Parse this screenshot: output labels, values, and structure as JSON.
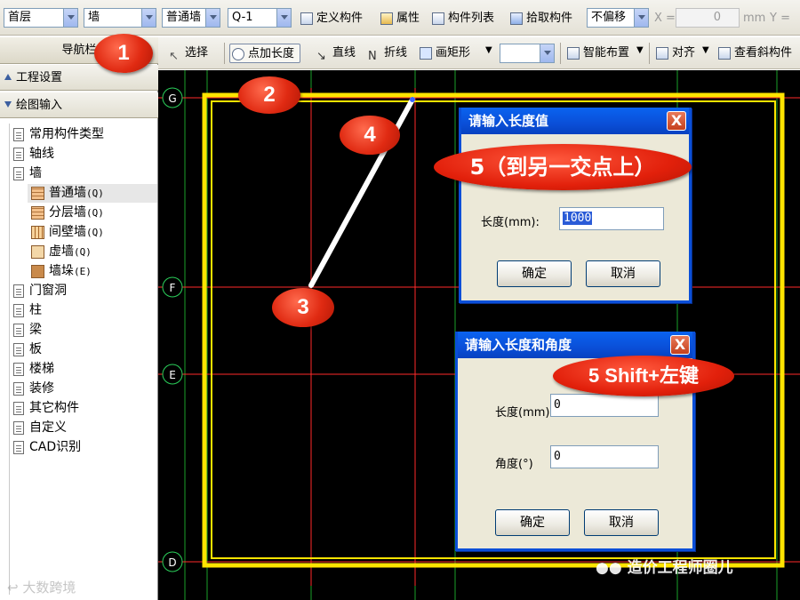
{
  "toolbar1": {
    "floor": "首层",
    "component_type": "墙",
    "wall_type": "普通墙",
    "wall_code": "Q-1",
    "define": "定义构件",
    "properties": "属性",
    "component_list": "构件列表",
    "pick": "拾取构件",
    "offset": "不偏移",
    "x_label": "X =",
    "x_value": "0",
    "unit": "mm",
    "y_label": "Y ="
  },
  "toolbar2": {
    "select": "选择",
    "point_length": "点加长度",
    "line": "直线",
    "polyline": "折线",
    "rect": "画矩形",
    "smart_layout": "智能布置",
    "align": "对齐",
    "view_slope": "查看斜构件"
  },
  "left_panel": {
    "title": "导航栏",
    "section_project": "工程设置",
    "section_draw": "绘图输入",
    "tree": [
      {
        "label": "常用构件类型"
      },
      {
        "label": "轴线"
      },
      {
        "label": "墙"
      },
      {
        "label": "普通墙",
        "code": "(Q)"
      },
      {
        "label": "分层墙",
        "code": "(Q)"
      },
      {
        "label": "间壁墙",
        "code": "(Q)"
      },
      {
        "label": "虚墙",
        "code": "(Q)"
      },
      {
        "label": "墙垛",
        "code": "(E)"
      },
      {
        "label": "门窗洞"
      },
      {
        "label": "柱"
      },
      {
        "label": "梁"
      },
      {
        "label": "板"
      },
      {
        "label": "楼梯"
      },
      {
        "label": "装修"
      },
      {
        "label": "其它构件"
      },
      {
        "label": "自定义"
      },
      {
        "label": "CAD识别"
      }
    ]
  },
  "canvas": {
    "axes": [
      "G",
      "F",
      "E",
      "D"
    ]
  },
  "dialog_length": {
    "title": "请输入长度值",
    "close": "X",
    "length_label": "长度(mm):",
    "length_value": "1000",
    "ok": "确定",
    "cancel": "取消"
  },
  "dialog_angle": {
    "title": "请输入长度和角度",
    "close": "X",
    "length_label": "长度(mm)",
    "length_value": "0",
    "angle_label": "角度(°)",
    "angle_value": "0",
    "ok": "确定",
    "cancel": "取消"
  },
  "callouts": {
    "c1": "1",
    "c2": "2",
    "c3": "3",
    "c4": "4",
    "c5a": "5（到另一交点上）",
    "c5b": "5  Shift+左键"
  },
  "watermarks": {
    "right": "造价工程师圈儿",
    "left": "大数跨境"
  },
  "colors": {
    "grid_axis": "#ff2a2a",
    "grid_green": "#1aa02a",
    "wall_yellow": "#ffe400",
    "callout_red": "#e02a12"
  }
}
